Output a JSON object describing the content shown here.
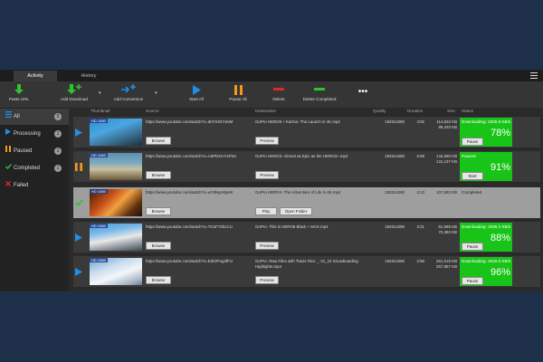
{
  "tabs": [
    {
      "label": "Activity",
      "active": true
    },
    {
      "label": "History",
      "active": false
    }
  ],
  "toolbar": {
    "paste_url": "Paste URL",
    "add_download": "Add Download",
    "add_conversion": "Add Conversion",
    "start_all": "Start All",
    "pause_all": "Pause All",
    "delete": "Delete",
    "delete_completed": "Delete Completed"
  },
  "sidebar": [
    {
      "label": "All",
      "count": "5",
      "icon": "list-icon"
    },
    {
      "label": "Processing",
      "count": "1",
      "icon": "play-icon"
    },
    {
      "label": "Paused",
      "count": "1",
      "icon": "pause-icon"
    },
    {
      "label": "Completed",
      "count": "1",
      "icon": "check-icon"
    },
    {
      "label": "Failed",
      "count": "",
      "icon": "x-icon"
    }
  ],
  "columns": {
    "thumbnail": "Thumbnail",
    "source": "Source",
    "destination": "Destination",
    "quality": "Quality",
    "duration": "Duration",
    "size": "Size",
    "status": "Status"
  },
  "rows": [
    {
      "state": "processing",
      "hd": "HD 1080",
      "source": "https://www.youtube.com/watch?v=iEtYSIOYxNM",
      "source_btn": "Browse",
      "destination": "GoPro HERO5 + Karma- The Launch in 4K.mp4",
      "dest_btns": [
        "Preview"
      ],
      "quality": "1920x1080",
      "duration": "4:02",
      "size1": "114,632 KB",
      "size2": "89,420 KB",
      "status": "Downloading: 3305.8 KB/s",
      "percent": 78,
      "percent_label": "78%",
      "action": "Pause"
    },
    {
      "state": "paused",
      "hd": "HD 1080",
      "source": "https://www.youtube.com/watch?v=A3PDXmYsF5U",
      "source_btn": "Browse",
      "destination": "GoPro HERO3- Almost as Epic as the HERO3+.mp4",
      "dest_btns": [
        "Preview"
      ],
      "quality": "1920x1080",
      "duration": "5:08",
      "size1": "144,590 KB",
      "size2": "131,137 KB",
      "status": "Paused",
      "percent": 91,
      "percent_label": "91%",
      "action": "Start"
    },
    {
      "state": "completed",
      "hd": "HD 1080",
      "source": "https://www.youtube.com/watch?v=wTdNgA6gH8",
      "source_btn": "Browse",
      "destination": "GoPro HERO4- The Adventure of Life in 4K.mp4",
      "dest_btns": [
        "Play",
        "Open Folder"
      ],
      "quality": "1920x1080",
      "duration": "4:13",
      "size1": "107,082 KB",
      "size2": "",
      "status": "Completed",
      "percent": 100,
      "percent_label": "",
      "action": ""
    },
    {
      "state": "processing",
      "hd": "HD 1080",
      "source": "https://www.youtube.com/watch?v=TOuF7ZbcCU",
      "source_btn": "Browse",
      "destination": "GoPro- This is HERO6 Black + MAX.mp4",
      "dest_btns": [
        "Preview"
      ],
      "quality": "1920x1080",
      "duration": "3:21",
      "size1": "81,695 KB",
      "size2": "72,382 KB",
      "status": "Downloading: 2096.0 KB/s",
      "percent": 88,
      "percent_label": "88%",
      "action": "Pause"
    },
    {
      "state": "processing",
      "hd": "HD 1080",
      "source": "https://www.youtube.com/watch?v=EdGPrsg4fFU",
      "source_btn": "Browse",
      "destination": "GoPro- Raw Files with Travis Rice _ '21_22 Snowboarding Highlights.mp4",
      "dest_btns": [
        "Preview"
      ],
      "quality": "1920x1080",
      "duration": "2:56",
      "size1": "261,019 KB",
      "size2": "257,857 KB",
      "status": "Downloading: 2840.0 KB/s",
      "percent": 96,
      "percent_label": "96%",
      "action": "Pause"
    }
  ],
  "colors": {
    "background": "#1e2f4a",
    "progress": "#19c419",
    "play_blue": "#1f8fe6",
    "pause_orange": "#f59a1a",
    "check_green": "#2ec42e",
    "fail_red": "#e0282a"
  }
}
